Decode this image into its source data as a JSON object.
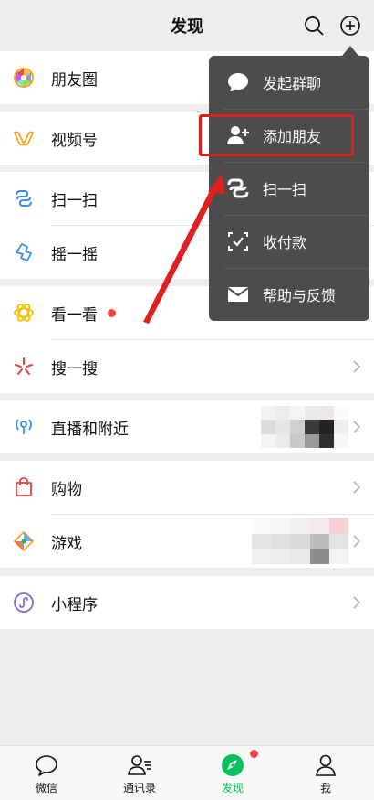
{
  "header": {
    "title": "发现",
    "search_icon": "search-icon",
    "plus_icon": "plus-circle-icon"
  },
  "discover": {
    "moments": "朋友圈",
    "channels": "视频号",
    "scan": "扫一扫",
    "shake": "摇一摇",
    "top_stories": "看一看",
    "search": "搜一搜",
    "nearby": "直播和附近",
    "shopping": "购物",
    "games": "游戏",
    "mini_programs": "小程序"
  },
  "popup": {
    "items": [
      {
        "label": "发起群聊",
        "icon": "chat-bubble-icon"
      },
      {
        "label": "添加朋友",
        "icon": "add-friend-icon"
      },
      {
        "label": "扫一扫",
        "icon": "scan-icon"
      },
      {
        "label": "收付款",
        "icon": "payment-icon"
      },
      {
        "label": "帮助与反馈",
        "icon": "mail-icon"
      }
    ],
    "highlighted": "添加朋友"
  },
  "tabbar": {
    "tabs": [
      {
        "label": "微信",
        "icon": "chat-icon"
      },
      {
        "label": "通讯录",
        "icon": "contacts-icon"
      },
      {
        "label": "发现",
        "icon": "compass-icon",
        "active": true
      },
      {
        "label": "我",
        "icon": "person-icon"
      }
    ]
  },
  "colors": {
    "accent": "#07c160",
    "badge": "#f54545",
    "annotation": "#e02020",
    "popup_bg": "#4c4c4c"
  }
}
